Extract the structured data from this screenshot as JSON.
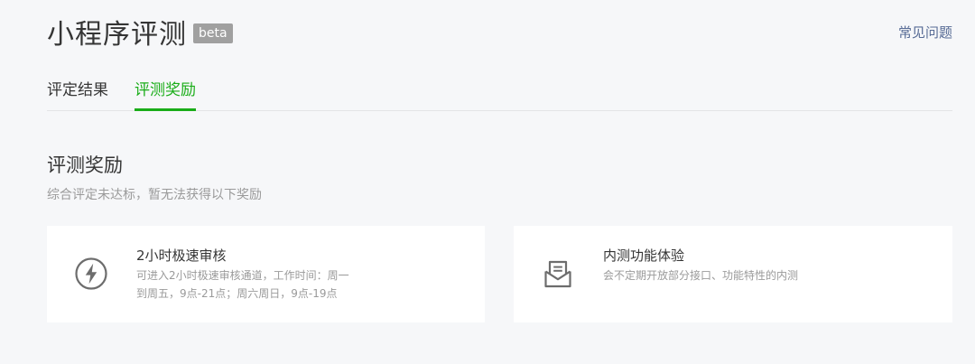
{
  "header": {
    "title": "小程序评测",
    "badge": "beta",
    "faq_link": "常见问题"
  },
  "tabs": [
    {
      "label": "评定结果",
      "active": false
    },
    {
      "label": "评测奖励",
      "active": true
    }
  ],
  "section": {
    "title": "评测奖励",
    "subtitle": "综合评定未达标，暂无法获得以下奖励"
  },
  "rewards": [
    {
      "icon": "lightning-icon",
      "title": "2小时极速审核",
      "desc_line1": "可进入2小时极速审核通道，工作时间：周一",
      "desc_line2": "到周五，9点-21点；周六周日，9点-19点"
    },
    {
      "icon": "envelope-icon",
      "title": "内测功能体验",
      "desc_line1": "会不定期开放部分接口、功能特性的内测",
      "desc_line2": ""
    }
  ],
  "colors": {
    "accent": "#1aad19",
    "link": "#576b95",
    "badge_bg": "#a0a0a0",
    "muted_text": "#9a9a9a",
    "icon_gray": "#6d6d6d"
  }
}
